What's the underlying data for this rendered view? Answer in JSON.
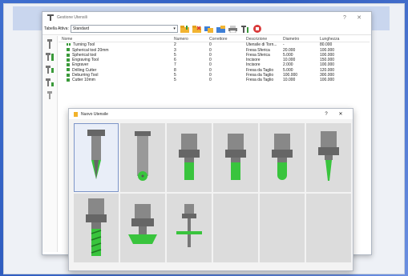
{
  "window": {
    "title": "Gestione Utensili",
    "minimize": "?",
    "close": "✕"
  },
  "toolbar": {
    "active_table_label": "Tabella Attiva:",
    "active_table_value": "Standard",
    "buttons": [
      "folder-new-icon",
      "folder-remove-icon",
      "folders-icon",
      "folder-copy-icon",
      "printer-icon",
      "tool-settings-icon",
      "stop-icon"
    ]
  },
  "table": {
    "headers": [
      "Nome",
      "Numero",
      "Correttore",
      "Descrizione",
      "Diametro",
      "Lunghezza"
    ],
    "rows": [
      {
        "name": "Turning Tool",
        "number": "2",
        "corr": "0",
        "desc": "Utensile di Torn...",
        "diam": "-",
        "len": "80.000"
      },
      {
        "name": "Spherical tool 20mm",
        "number": "3",
        "corr": "0",
        "desc": "Fresa Sferica",
        "diam": "20.000",
        "len": "100.000"
      },
      {
        "name": "Spherical tool",
        "number": "5",
        "corr": "0",
        "desc": "Fresa Sferica",
        "diam": "5.000",
        "len": "100.000"
      },
      {
        "name": "Engraving Tool",
        "number": "6",
        "corr": "0",
        "desc": "Incisore",
        "diam": "10.000",
        "len": "150.000"
      },
      {
        "name": "Engraver",
        "number": "7",
        "corr": "0",
        "desc": "Incisore",
        "diam": "2.000",
        "len": "100.000"
      },
      {
        "name": "Drilling Cutter",
        "number": "8",
        "corr": "0",
        "desc": "Fresa da Taglio",
        "diam": "5.000",
        "len": "120.000"
      },
      {
        "name": "Deburring Tool",
        "number": "5",
        "corr": "0",
        "desc": "Fresa da Taglio",
        "diam": "100.000",
        "len": "300.000"
      },
      {
        "name": "Cutter 10mm",
        "number": "5",
        "corr": "0",
        "desc": "Fresa da Taglio",
        "diam": "10.000",
        "len": "100.000"
      }
    ]
  },
  "dialog": {
    "title": "Nuovo Utensile",
    "help": "?",
    "close": "✕",
    "tools": [
      "engraver-v-tool-icon",
      "spherical-tool-icon",
      "flat-end-mill-icon",
      "flat-end-mill-icon",
      "ball-end-mill-icon",
      "tapered-tool-icon",
      "drill-cutter-icon",
      "face-mill-icon",
      "slot-cutter-icon",
      "",
      "",
      ""
    ]
  },
  "colors": {
    "accent": "#3fbf3f",
    "background": "#2f5dc0"
  }
}
